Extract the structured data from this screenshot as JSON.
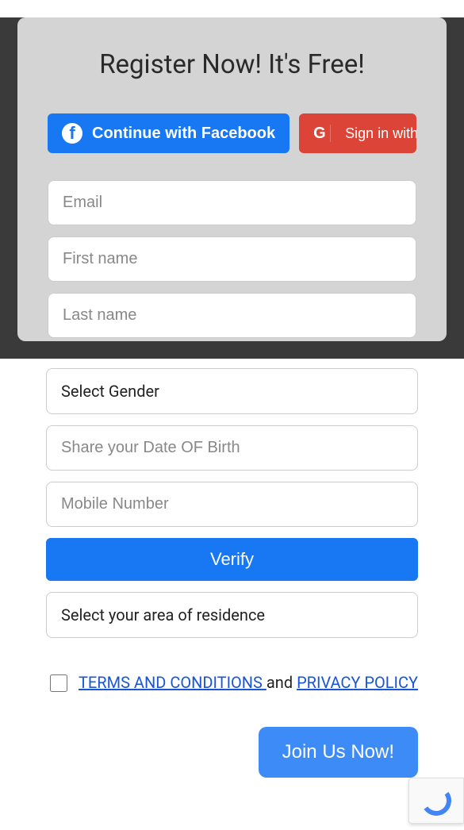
{
  "title": "Register Now! It's Free!",
  "social": {
    "facebook_label": "Continue with Facebook",
    "google_label": "Sign in with Goo"
  },
  "fields": {
    "email_placeholder": "Email",
    "firstname_placeholder": "First name",
    "lastname_placeholder": "Last name",
    "gender_label": "Select Gender",
    "dob_placeholder": "Share your Date OF Birth",
    "mobile_placeholder": "Mobile Number",
    "area_label": "Select your area of residence"
  },
  "buttons": {
    "verify": "Verify",
    "join": "Join Us Now!"
  },
  "terms": {
    "terms_link": "TERMS AND CONDITIONS ",
    "and_text": "and ",
    "privacy_link": "PRIVACY POLICY"
  }
}
